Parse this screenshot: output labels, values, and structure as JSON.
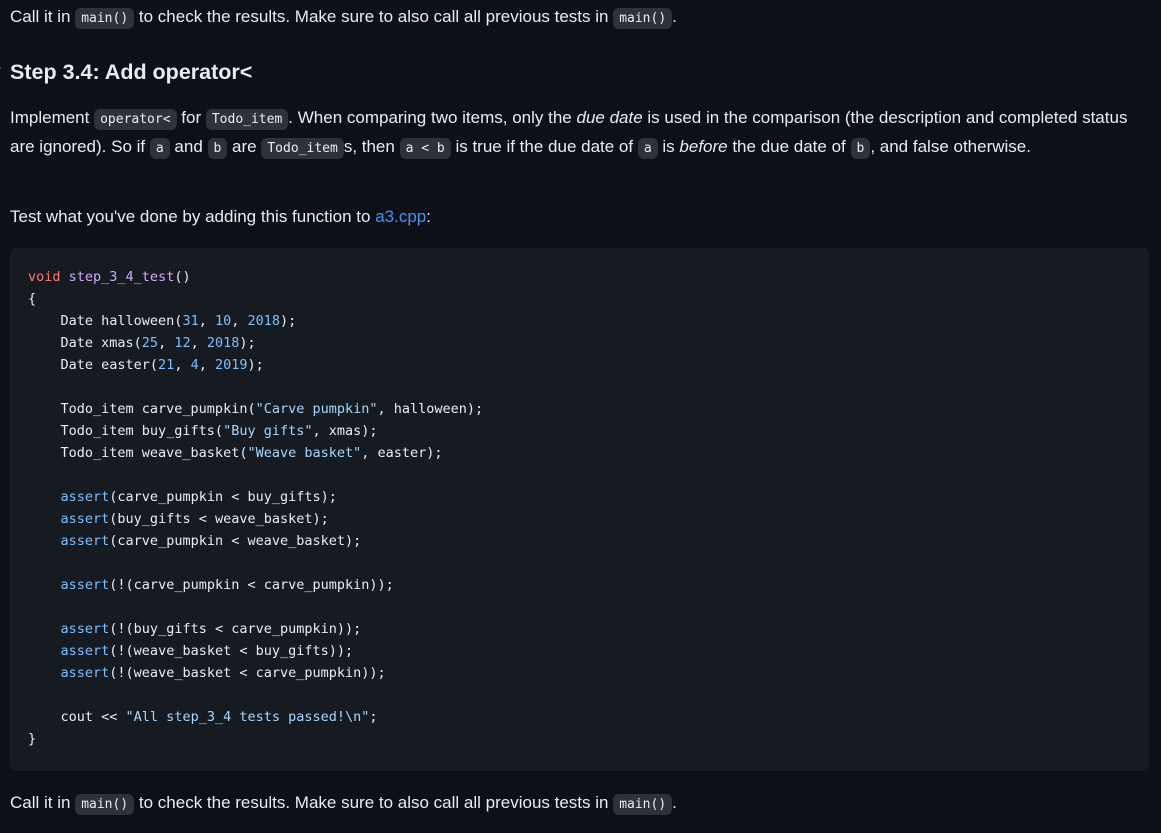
{
  "top_para": {
    "t1": "Call it in ",
    "code1": "main()",
    "t2": " to check the results. Make sure to also call all previous tests in ",
    "code2": "main()",
    "t3": "."
  },
  "heading": {
    "anchor": "?",
    "text": "Step 3.4: Add operator<"
  },
  "impl_para": {
    "t1": "Implement ",
    "code_op": "operator<",
    "t2": " for ",
    "code_todo": "Todo_item",
    "t3": ". When comparing two items, only the ",
    "em_due": "due date",
    "t4": " is used in the comparison (the description and completed status are ignored). So if ",
    "code_a": "a",
    "t5": " and ",
    "code_b": "b",
    "t6": " are ",
    "code_todo2": "Todo_item",
    "t7": "s, then ",
    "code_alt": "a < b",
    "t8": " is true if the due date of ",
    "code_a2": "a",
    "t9": " is ",
    "em_before": "before",
    "t10": " the due date of ",
    "code_b2": "b",
    "t11": ", and false otherwise."
  },
  "test_para": {
    "t1": "Test what you've done by adding this function to ",
    "link": "a3.cpp",
    "t2": ":"
  },
  "code": {
    "l1_kw": "void",
    "l1_fn": "step_3_4_test",
    "l1_rest": "()",
    "l2": "{",
    "l3_a": "    Date halloween(",
    "l3_n1": "31",
    "l3_s1": ", ",
    "l3_n2": "10",
    "l3_s2": ", ",
    "l3_n3": "2018",
    "l3_b": ");",
    "l4_a": "    Date xmas(",
    "l4_n1": "25",
    "l4_s1": ", ",
    "l4_n2": "12",
    "l4_s2": ", ",
    "l4_n3": "2018",
    "l4_b": ");",
    "l5_a": "    Date easter(",
    "l5_n1": "21",
    "l5_s1": ", ",
    "l5_n2": "4",
    "l5_s2": ", ",
    "l5_n3": "2019",
    "l5_b": ");",
    "l7_a": "    Todo_item carve_pumpkin(",
    "l7_str": "\"Carve pumpkin\"",
    "l7_b": ", halloween);",
    "l8_a": "    Todo_item buy_gifts(",
    "l8_str": "\"Buy gifts\"",
    "l8_b": ", xmas);",
    "l9_a": "    Todo_item weave_basket(",
    "l9_str": "\"Weave basket\"",
    "l9_b": ", easter);",
    "assert_kw": "assert",
    "l11_b": "(carve_pumpkin < buy_gifts);",
    "l12_b": "(buy_gifts < weave_basket);",
    "l13_b": "(carve_pumpkin < weave_basket);",
    "l15_b": "(!(carve_pumpkin < carve_pumpkin));",
    "l17_b": "(!(buy_gifts < carve_pumpkin));",
    "l18_b": "(!(weave_basket < buy_gifts));",
    "l19_b": "(!(weave_basket < carve_pumpkin));",
    "l21_a": "    cout << ",
    "l21_str": "\"All step_3_4 tests passed!\\n\"",
    "l21_b": ";",
    "l22": "}",
    "indent": "    "
  },
  "bottom_para": {
    "t1": "Call it in ",
    "code1": "main()",
    "t2": " to check the results. Make sure to also call all previous tests in ",
    "code2": "main()",
    "t3": "."
  },
  "colors": {
    "background": "#0d1117",
    "text": "#e6edf3",
    "code_bg": "#161b22",
    "inline_code_bg": "#2d333b",
    "link": "#4493f8",
    "keyword": "#ff7b72",
    "function": "#d2a8ff",
    "number": "#79c0ff",
    "string": "#a5d6ff"
  }
}
